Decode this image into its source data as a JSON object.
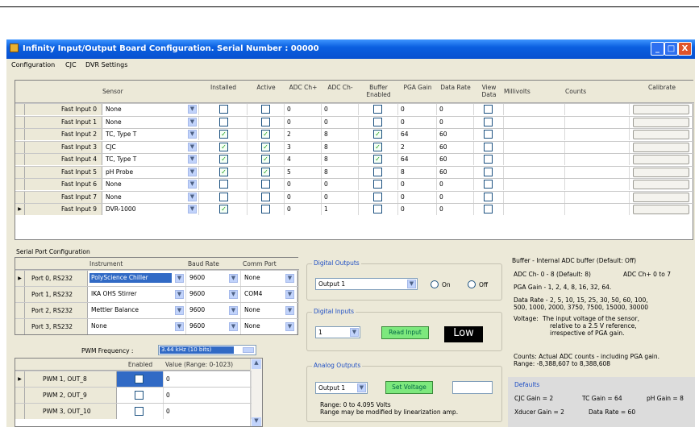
{
  "window": {
    "title": "Infinity Input/Output Board Configuration.   Serial Number : 00000",
    "buttons": [
      "_",
      "□",
      "X"
    ]
  },
  "menu": [
    "Configuration",
    "CJC",
    "DVR Settings"
  ],
  "inputs": {
    "headers": [
      "Sensor",
      "Installed",
      "Active",
      "ADC Ch+",
      "ADC Ch-",
      "Buffer Enabled",
      "PGA Gain",
      "Data Rate",
      "View Data",
      "Millivolts",
      "Counts",
      "Calibrate"
    ],
    "rows": [
      {
        "name": "Fast Input 0",
        "sensor": "None",
        "installed": false,
        "active": false,
        "adc_pos": "0",
        "adc_neg": "0",
        "buffer": false,
        "pga": "0",
        "rate": "0",
        "view": false,
        "selected": false
      },
      {
        "name": "Fast Input 1",
        "sensor": "None",
        "installed": false,
        "active": false,
        "adc_pos": "0",
        "adc_neg": "0",
        "buffer": false,
        "pga": "0",
        "rate": "0",
        "view": false,
        "selected": false
      },
      {
        "name": "Fast Input 2",
        "sensor": "TC, Type T",
        "installed": true,
        "active": true,
        "adc_pos": "2",
        "adc_neg": "8",
        "buffer": true,
        "pga": "64",
        "rate": "60",
        "view": false,
        "selected": false
      },
      {
        "name": "Fast Input 3",
        "sensor": "CJC",
        "installed": true,
        "active": true,
        "adc_pos": "3",
        "adc_neg": "8",
        "buffer": true,
        "pga": "2",
        "rate": "60",
        "view": false,
        "selected": false
      },
      {
        "name": "Fast Input 4",
        "sensor": "TC, Type T",
        "installed": true,
        "active": true,
        "adc_pos": "4",
        "adc_neg": "8",
        "buffer": true,
        "pga": "64",
        "rate": "60",
        "view": false,
        "selected": false
      },
      {
        "name": "Fast Input 5",
        "sensor": "pH Probe",
        "installed": true,
        "active": true,
        "adc_pos": "5",
        "adc_neg": "8",
        "buffer": false,
        "pga": "8",
        "rate": "60",
        "view": false,
        "selected": false
      },
      {
        "name": "Fast Input 6",
        "sensor": "None",
        "installed": false,
        "active": false,
        "adc_pos": "0",
        "adc_neg": "0",
        "buffer": false,
        "pga": "0",
        "rate": "0",
        "view": false,
        "selected": false
      },
      {
        "name": "Fast Input 7",
        "sensor": "None",
        "installed": false,
        "active": false,
        "adc_pos": "0",
        "adc_neg": "0",
        "buffer": false,
        "pga": "0",
        "rate": "0",
        "view": false,
        "selected": false
      },
      {
        "name": "Fast Input 9",
        "sensor": "DVR-1000",
        "installed": true,
        "active": false,
        "adc_pos": "0",
        "adc_neg": "1",
        "buffer": false,
        "pga": "0",
        "rate": "0",
        "view": false,
        "selected": true
      }
    ]
  },
  "serial": {
    "label": "Serial Port Configuration",
    "headers": [
      "Instrument",
      "Baud Rate",
      "Comm Port"
    ],
    "rows": [
      {
        "name": "Port 0, RS232",
        "instrument": "PolyScience Chiller",
        "baud": "9600",
        "port": "None",
        "selected": true
      },
      {
        "name": "Port 1, RS232",
        "instrument": "IKA OHS Stirrer",
        "baud": "9600",
        "port": "COM4",
        "selected": false
      },
      {
        "name": "Port 2, RS232",
        "instrument": "Mettler Balance",
        "baud": "9600",
        "port": "None",
        "selected": false
      },
      {
        "name": "Port 3, RS232",
        "instrument": "None",
        "baud": "9600",
        "port": "None",
        "selected": false
      }
    ]
  },
  "pwm": {
    "freq_label": "PWM Frequency :",
    "freq_value": "3.44 kHz (10 bits)",
    "headers": [
      "Enabled",
      "Value (Range: 0-1023)"
    ],
    "rows": [
      {
        "name": "PWM 1, OUT_8",
        "value": "0",
        "selected": true
      },
      {
        "name": "PWM 2, OUT_9",
        "value": "0",
        "selected": false
      },
      {
        "name": "PWM 3, OUT_10",
        "value": "0",
        "selected": false
      }
    ]
  },
  "digital_outputs": {
    "title": "Digital Outputs",
    "selected": "Output 1",
    "on_label": "On",
    "off_label": "Off"
  },
  "digital_inputs": {
    "title": "Digital Inputs",
    "selected": "1",
    "read_label": "Read Input",
    "state": "Low"
  },
  "analog_outputs": {
    "title": "Analog Outputs",
    "selected": "Output 1",
    "set_label": "Set Voltage",
    "value": "",
    "range1": "Range: 0 to 4.095 Volts",
    "range2": "Range may be modified by linearization amp."
  },
  "info": {
    "buffer": "Buffer - Internal ADC buffer (Default: Off)",
    "adc_neg": "ADC Ch-   0 - 8 (Default: 8)",
    "adc_pos": "ADC Ch+   0 to 7",
    "pga": "PGA Gain - 1, 2, 4, 8, 16, 32, 64.",
    "rate1": "Data Rate - 2, 5, 10, 15, 25, 30, 50, 60, 100,",
    "rate2": "500, 1000, 2000, 3750, 7500, 15000, 30000",
    "voltage_label": "Voltage:",
    "voltage1": "The input voltage of the sensor,",
    "voltage2": "relative to a 2.5 V reference,",
    "voltage3": "irrespective of PGA gain.",
    "counts1": "Counts:  Actual ADC counts - including PGA gain.",
    "counts2": "Range:  -8,388,607 to 8,388,608"
  },
  "defaults": {
    "title": "Defaults",
    "cjc": "CJC Gain = 2",
    "tc": "TC Gain = 64",
    "ph": "pH Gain = 8",
    "xducer": "Xducer Gain = 2",
    "rate": "Data Rate = 60"
  }
}
